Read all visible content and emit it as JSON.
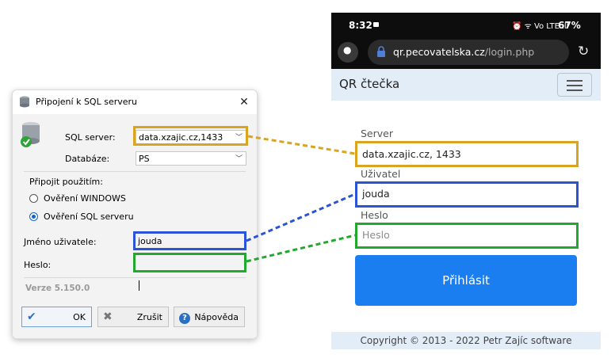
{
  "dialog": {
    "title": "Připojení k SQL serveru",
    "sql_server_label": "SQL server:",
    "sql_server_value": "data.xzajic.cz,1433",
    "database_label": "Databáze:",
    "database_value": "PS",
    "connect_using_label": "Připojit použitím:",
    "auth_windows": "Ověření WINDOWS",
    "auth_sql": "Ověření SQL serveru",
    "username_label": "Jméno uživatele:",
    "username_value": "jouda",
    "password_label": "Heslo:",
    "password_value": "",
    "version": "Verze 5.150.0",
    "ok_label": "OK",
    "cancel_label": "Zrušit",
    "help_label": "Nápověda",
    "selected_auth": "sql"
  },
  "phone": {
    "status": {
      "time": "8:32",
      "icons": "⏰ ᯤ Vo LTE ıll",
      "battery": "67%"
    },
    "url": {
      "domain": "qr.pecovatelska.cz",
      "path": "/login.php"
    },
    "brand": "QR čtečka",
    "server_label": "Server",
    "server_value": "data.xzajic.cz, 1433",
    "user_label": "Uživatel",
    "user_value": "jouda",
    "password_label": "Heslo",
    "password_placeholder": "Heslo",
    "login_button": "Přihlásit",
    "footer": "Copyright © 2013 - 2022 Petr Zajíc software"
  },
  "colors": {
    "server_highlight": "#d9a520",
    "user_highlight": "#2b53d6",
    "password_highlight": "#22a82f",
    "login_button": "#1a7df0",
    "navbar_bg": "#e2edf7"
  }
}
